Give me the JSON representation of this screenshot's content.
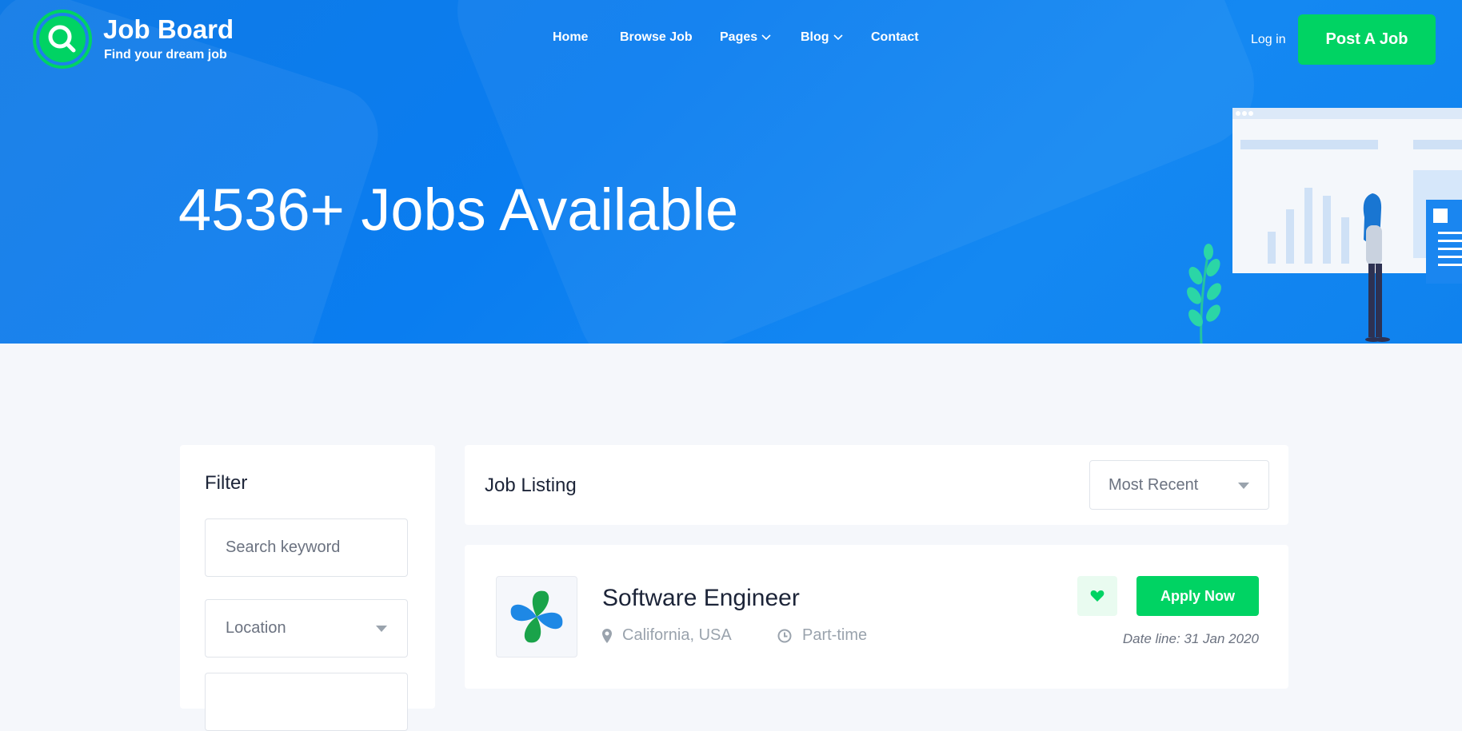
{
  "brand": {
    "title": "Job Board",
    "tagline": "Find your dream job",
    "logo_icon": "search-icon",
    "accent": "#00d363"
  },
  "nav": {
    "items": [
      {
        "label": "Home",
        "has_dropdown": false
      },
      {
        "label": "Browse Job",
        "has_dropdown": false
      },
      {
        "label": "Pages",
        "has_dropdown": true
      },
      {
        "label": "Blog",
        "has_dropdown": true
      },
      {
        "label": "Contact",
        "has_dropdown": false
      }
    ],
    "login_label": "Log in",
    "post_job_label": "Post A Job"
  },
  "hero": {
    "title": "4536+ Jobs Available",
    "background": "#0a7df0"
  },
  "filter": {
    "title": "Filter",
    "search_placeholder": "Search keyword",
    "location_selected": "Location"
  },
  "listing": {
    "title": "Job Listing",
    "sort_selected": "Most Recent"
  },
  "jobs": [
    {
      "title": "Software Engineer",
      "location": "California, USA",
      "type": "Part-time",
      "apply_label": "Apply Now",
      "deadline": "Date line: 31 Jan 2020",
      "location_icon": "map-pin-icon",
      "type_icon": "clock-icon",
      "favorite_icon": "heart-icon"
    }
  ]
}
